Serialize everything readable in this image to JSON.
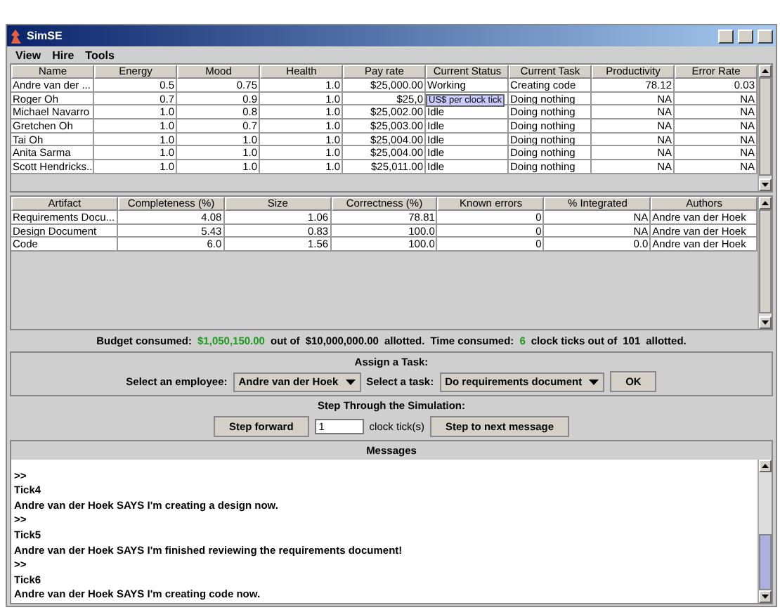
{
  "window": {
    "title": "SimSE"
  },
  "menu": [
    "View",
    "Hire",
    "Tools"
  ],
  "employees": {
    "columns": [
      "Name",
      "Energy",
      "Mood",
      "Health",
      "Pay rate",
      "Current Status",
      "Current Task",
      "Productivity",
      "Error Rate"
    ],
    "rows": [
      [
        "Andre van der ...",
        "0.5",
        "0.75",
        "1.0",
        "$25,000.00",
        "Working",
        "Creating code",
        "78.12",
        "0.03"
      ],
      [
        "Roger Oh",
        "0.7",
        "0.9",
        "1.0",
        "$25,0",
        null,
        "Doing nothing",
        "NA",
        "NA"
      ],
      [
        "Michael Navarro",
        "1.0",
        "0.8",
        "1.0",
        "$25,002.00",
        "Idle",
        "Doing nothing",
        "NA",
        "NA"
      ],
      [
        "Gretchen Oh",
        "1.0",
        "0.7",
        "1.0",
        "$25,003.00",
        "Idle",
        "Doing nothing",
        "NA",
        "NA"
      ],
      [
        "Tai Oh",
        "1.0",
        "1.0",
        "1.0",
        "$25,004.00",
        "Idle",
        "Doing nothing",
        "NA",
        "NA"
      ],
      [
        "Anita Sarma",
        "1.0",
        "1.0",
        "1.0",
        "$25,004.00",
        "Idle",
        "Doing nothing",
        "NA",
        "NA"
      ],
      [
        "Scott Hendricks...",
        "1.0",
        "1.0",
        "1.0",
        "$25,011.00",
        "Idle",
        "Doing nothing",
        "NA",
        "NA"
      ]
    ],
    "tooltip": "US$ per clock tick"
  },
  "artifacts": {
    "columns": [
      "Artifact",
      "Completeness (%)",
      "Size",
      "Correctness (%)",
      "Known errors",
      "% Integrated",
      "Authors"
    ],
    "rows": [
      [
        "Requirements Docu...",
        "4.08",
        "1.06",
        "78.81",
        "0",
        "NA",
        "Andre van der Hoek"
      ],
      [
        "Design Document",
        "5.43",
        "0.83",
        "100.0",
        "0",
        "NA",
        "Andre van der Hoek"
      ],
      [
        "Code",
        "6.0",
        "1.56",
        "100.0",
        "0",
        "0.0",
        "Andre van der Hoek"
      ]
    ]
  },
  "status_line": [
    {
      "text": "Budget consumed:",
      "highlight": false
    },
    {
      "text": "$1,050,150.00",
      "highlight": true
    },
    {
      "text": "out of",
      "highlight": false
    },
    {
      "text": "$10,000,000.00",
      "highlight": false
    },
    {
      "text": "allotted.",
      "highlight": false
    },
    {
      "text": "Time consumed:",
      "highlight": false
    },
    {
      "text": "6",
      "highlight": true
    },
    {
      "text": "clock ticks out of",
      "highlight": false
    },
    {
      "text": "101",
      "highlight": false
    },
    {
      "text": "allotted.",
      "highlight": false
    }
  ],
  "assign": {
    "title": "Assign a Task:",
    "employee_label": "Select an employee:",
    "employee": "Andre van der Hoek",
    "task_label": "Select a task:",
    "task": "Do requirements document",
    "ok": "OK"
  },
  "step": {
    "title": "Step Through the Simulation:",
    "forward": "Step forward",
    "ticks": "1",
    "ticks_label": "clock tick(s)",
    "next": "Step to next message"
  },
  "messages": {
    "title": "Messages",
    "lines": [
      ">>",
      "Tick4",
      "Andre van der Hoek SAYS I'm creating a design now.",
      ">>",
      "Tick5",
      "Andre van der Hoek SAYS I'm finished reviewing the requirements document!",
      ">>",
      "Tick6",
      "Andre van der Hoek SAYS I'm creating code now."
    ]
  }
}
